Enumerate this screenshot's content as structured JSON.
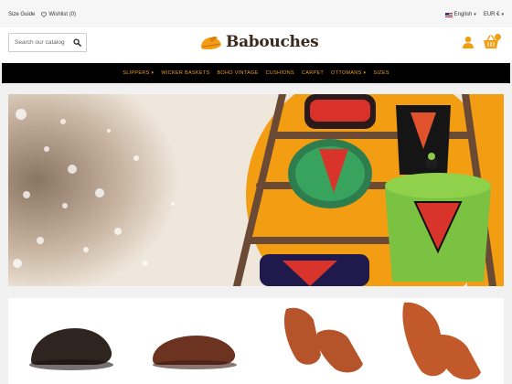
{
  "topbar": {
    "size_guide": "Size Guide",
    "wishlist": "Wishlist (0)",
    "language": "English",
    "currency": "EUR €"
  },
  "search": {
    "placeholder": "Search our catalog"
  },
  "brand": {
    "name": "Babouches"
  },
  "nav": {
    "items": [
      {
        "label": "SLIPPERS",
        "has_dropdown": true
      },
      {
        "label": "WICKER BASKETS",
        "has_dropdown": false
      },
      {
        "label": "BOHO VINTAGE",
        "has_dropdown": false
      },
      {
        "label": "CUSHIONS",
        "has_dropdown": false
      },
      {
        "label": "CARPET",
        "has_dropdown": false
      },
      {
        "label": "OTTOMANS",
        "has_dropdown": true
      },
      {
        "label": "SIZES",
        "has_dropdown": false
      }
    ]
  },
  "colors": {
    "accent": "#f39d13",
    "nav_background": "#000000",
    "page_background": "#f1f1f1"
  },
  "products": [
    {
      "color": "#2f2520"
    },
    {
      "color": "#6b3320"
    },
    {
      "color": "#b5542a"
    },
    {
      "color": "#c1592b"
    }
  ]
}
